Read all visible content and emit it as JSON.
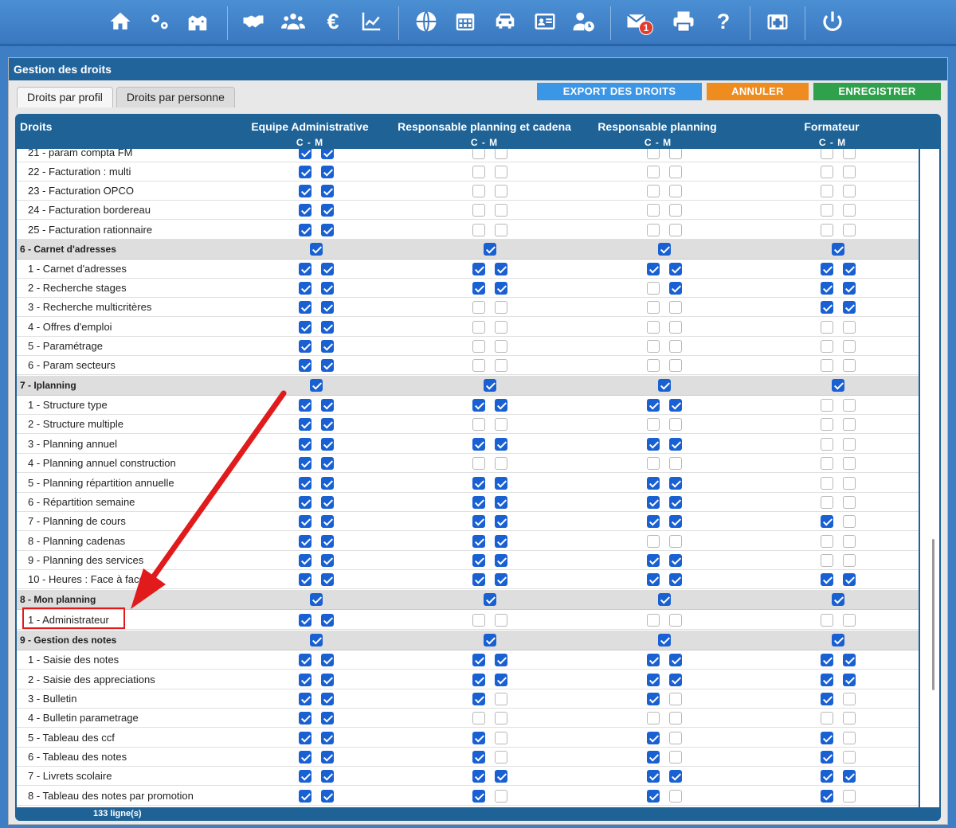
{
  "toolbar": {
    "icons": [
      "home-icon",
      "gears-icon",
      "building-icon",
      "handshake-icon",
      "users-icon",
      "euro-icon",
      "chart-line-icon",
      "globe-icon",
      "calendar-icon",
      "car-icon",
      "id-card-icon",
      "user-clock-icon",
      "mail-icon",
      "printer-icon",
      "help-icon",
      "medical-icon",
      "power-icon"
    ],
    "euro": "€",
    "help": "?",
    "mail_badge": "1"
  },
  "panel": {
    "title": "Gestion des droits"
  },
  "tabs": [
    {
      "label": "Droits par profil",
      "active": true
    },
    {
      "label": "Droits par personne",
      "active": false
    }
  ],
  "actions": {
    "export": "EXPORT DES DROITS",
    "cancel": "ANNULER",
    "save": "ENREGISTRER"
  },
  "colors": {
    "checked": "#1960d2",
    "header": "#1e6296",
    "export": "#3b96e6",
    "cancel": "#ef8c1f",
    "save": "#2fa14b",
    "annotation": "#e11b1b"
  },
  "table": {
    "col_droits": "Droits",
    "profiles": [
      {
        "name": "Equipe Administrative",
        "sub": "C - M"
      },
      {
        "name": "Responsable planning et cadena",
        "sub": "C - M"
      },
      {
        "name": "Responsable planning",
        "sub": "C - M"
      },
      {
        "name": "Formateur",
        "sub": "C - M"
      }
    ],
    "rows": [
      {
        "label": "21 - param compta FM",
        "type": "item",
        "values": [
          1,
          1,
          0,
          0,
          0,
          0,
          0,
          0
        ]
      },
      {
        "label": "22 - Facturation : multi",
        "type": "item",
        "values": [
          1,
          1,
          0,
          0,
          0,
          0,
          0,
          0
        ]
      },
      {
        "label": "23 - Facturation OPCO",
        "type": "item",
        "values": [
          1,
          1,
          0,
          0,
          0,
          0,
          0,
          0
        ]
      },
      {
        "label": "24 - Facturation bordereau",
        "type": "item",
        "values": [
          1,
          1,
          0,
          0,
          0,
          0,
          0,
          0
        ]
      },
      {
        "label": "25 - Facturation rationnaire",
        "type": "item",
        "values": [
          1,
          1,
          0,
          0,
          0,
          0,
          0,
          0
        ]
      },
      {
        "label": "6 - Carnet d'adresses",
        "type": "section",
        "values": [
          1,
          1,
          1,
          1
        ]
      },
      {
        "label": "1 - Carnet d'adresses",
        "type": "item",
        "values": [
          1,
          1,
          1,
          1,
          1,
          1,
          1,
          1
        ]
      },
      {
        "label": "2 - Recherche stages",
        "type": "item",
        "values": [
          1,
          1,
          1,
          1,
          0,
          1,
          1,
          1
        ]
      },
      {
        "label": "3 - Recherche multicritères",
        "type": "item",
        "values": [
          1,
          1,
          0,
          0,
          0,
          0,
          1,
          1
        ]
      },
      {
        "label": "4 - Offres d'emploi",
        "type": "item",
        "values": [
          1,
          1,
          0,
          0,
          0,
          0,
          0,
          0
        ]
      },
      {
        "label": "5 - Paramétrage",
        "type": "item",
        "values": [
          1,
          1,
          0,
          0,
          0,
          0,
          0,
          0
        ]
      },
      {
        "label": "6 - Param secteurs",
        "type": "item",
        "values": [
          1,
          1,
          0,
          0,
          0,
          0,
          0,
          0
        ]
      },
      {
        "label": "7 - Iplanning",
        "type": "section",
        "values": [
          1,
          1,
          1,
          1
        ]
      },
      {
        "label": "1 - Structure type",
        "type": "item",
        "values": [
          1,
          1,
          1,
          1,
          1,
          1,
          0,
          0
        ]
      },
      {
        "label": "2 - Structure multiple",
        "type": "item",
        "values": [
          1,
          1,
          0,
          0,
          0,
          0,
          0,
          0
        ]
      },
      {
        "label": "3 - Planning annuel",
        "type": "item",
        "values": [
          1,
          1,
          1,
          1,
          1,
          1,
          0,
          0
        ]
      },
      {
        "label": "4 - Planning annuel construction",
        "type": "item",
        "values": [
          1,
          1,
          0,
          0,
          0,
          0,
          0,
          0
        ]
      },
      {
        "label": "5 - Planning répartition annuelle",
        "type": "item",
        "values": [
          1,
          1,
          1,
          1,
          1,
          1,
          0,
          0
        ]
      },
      {
        "label": "6 - Répartition semaine",
        "type": "item",
        "values": [
          1,
          1,
          1,
          1,
          1,
          1,
          0,
          0
        ]
      },
      {
        "label": "7 - Planning de cours",
        "type": "item",
        "values": [
          1,
          1,
          1,
          1,
          1,
          1,
          1,
          0
        ]
      },
      {
        "label": "8 - Planning cadenas",
        "type": "item",
        "values": [
          1,
          1,
          1,
          1,
          0,
          0,
          0,
          0
        ]
      },
      {
        "label": "9 - Planning des services",
        "type": "item",
        "values": [
          1,
          1,
          1,
          1,
          1,
          1,
          0,
          0
        ]
      },
      {
        "label": "10 - Heures : Face à face",
        "type": "item",
        "values": [
          1,
          1,
          1,
          1,
          1,
          1,
          1,
          1
        ]
      },
      {
        "label": "8 - Mon planning",
        "type": "section",
        "values": [
          1,
          1,
          1,
          1
        ]
      },
      {
        "label": "1 - Administrateur",
        "type": "item",
        "values": [
          1,
          1,
          0,
          0,
          0,
          0,
          0,
          0
        ]
      },
      {
        "label": "9 - Gestion des notes",
        "type": "section",
        "values": [
          1,
          1,
          1,
          1
        ]
      },
      {
        "label": "1 - Saisie des notes",
        "type": "item",
        "values": [
          1,
          1,
          1,
          1,
          1,
          1,
          1,
          1
        ]
      },
      {
        "label": "2 - Saisie des appreciations",
        "type": "item",
        "values": [
          1,
          1,
          1,
          1,
          1,
          1,
          1,
          1
        ]
      },
      {
        "label": "3 - Bulletin",
        "type": "item",
        "values": [
          1,
          1,
          1,
          0,
          1,
          0,
          1,
          0
        ]
      },
      {
        "label": "4 - Bulletin parametrage",
        "type": "item",
        "values": [
          1,
          1,
          0,
          0,
          0,
          0,
          0,
          0
        ]
      },
      {
        "label": "5 - Tableau des ccf",
        "type": "item",
        "values": [
          1,
          1,
          1,
          0,
          1,
          0,
          1,
          0
        ]
      },
      {
        "label": "6 - Tableau des notes",
        "type": "item",
        "values": [
          1,
          1,
          1,
          0,
          1,
          0,
          1,
          0
        ]
      },
      {
        "label": "7 - Livrets scolaire",
        "type": "item",
        "values": [
          1,
          1,
          1,
          1,
          1,
          1,
          1,
          1
        ]
      },
      {
        "label": "8 - Tableau des notes par promotion",
        "type": "item",
        "values": [
          1,
          1,
          1,
          0,
          1,
          0,
          1,
          0
        ]
      }
    ],
    "footer": "133 ligne(s)"
  }
}
